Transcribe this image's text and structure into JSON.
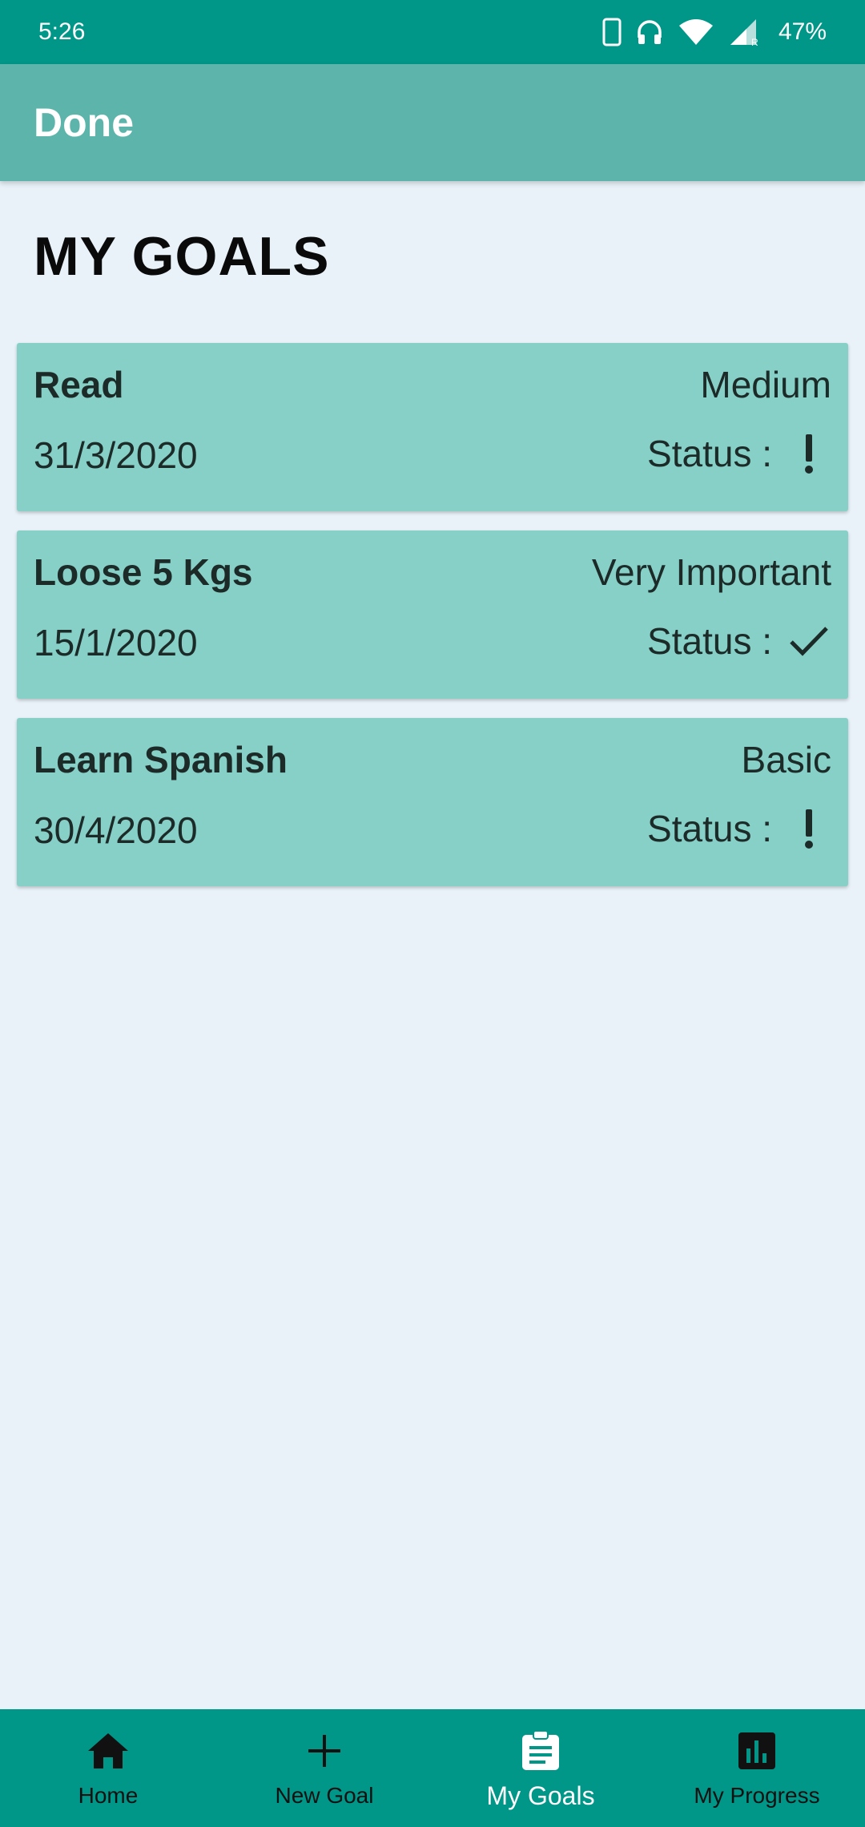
{
  "status_bar": {
    "time": "5:26",
    "battery": "47%",
    "icons": [
      "phone-icon",
      "headphones-icon",
      "wifi-icon",
      "signal-icon"
    ]
  },
  "app_bar": {
    "title": "Done"
  },
  "page": {
    "heading": "MY GOALS"
  },
  "goals": [
    {
      "title": "Read",
      "priority": "Medium",
      "date": "31/3/2020",
      "status_label": "Status :",
      "status_icon": "exclamation-icon"
    },
    {
      "title": "Loose 5 Kgs",
      "priority": "Very Important",
      "date": "15/1/2020",
      "status_label": "Status :",
      "status_icon": "check-icon"
    },
    {
      "title": "Learn Spanish",
      "priority": "Basic",
      "date": "30/4/2020",
      "status_label": "Status :",
      "status_icon": "exclamation-icon"
    }
  ],
  "bottom_nav": {
    "items": [
      {
        "label": "Home",
        "icon": "home-icon",
        "active": false
      },
      {
        "label": "New Goal",
        "icon": "plus-icon",
        "active": false
      },
      {
        "label": "My Goals",
        "icon": "clipboard-icon",
        "active": true
      },
      {
        "label": "My Progress",
        "icon": "bar-chart-icon",
        "active": false
      }
    ]
  },
  "colors": {
    "primary": "#009688",
    "app_bar": "#5cb4aa",
    "card": "#87d0c8",
    "background": "#e8f2f8"
  }
}
